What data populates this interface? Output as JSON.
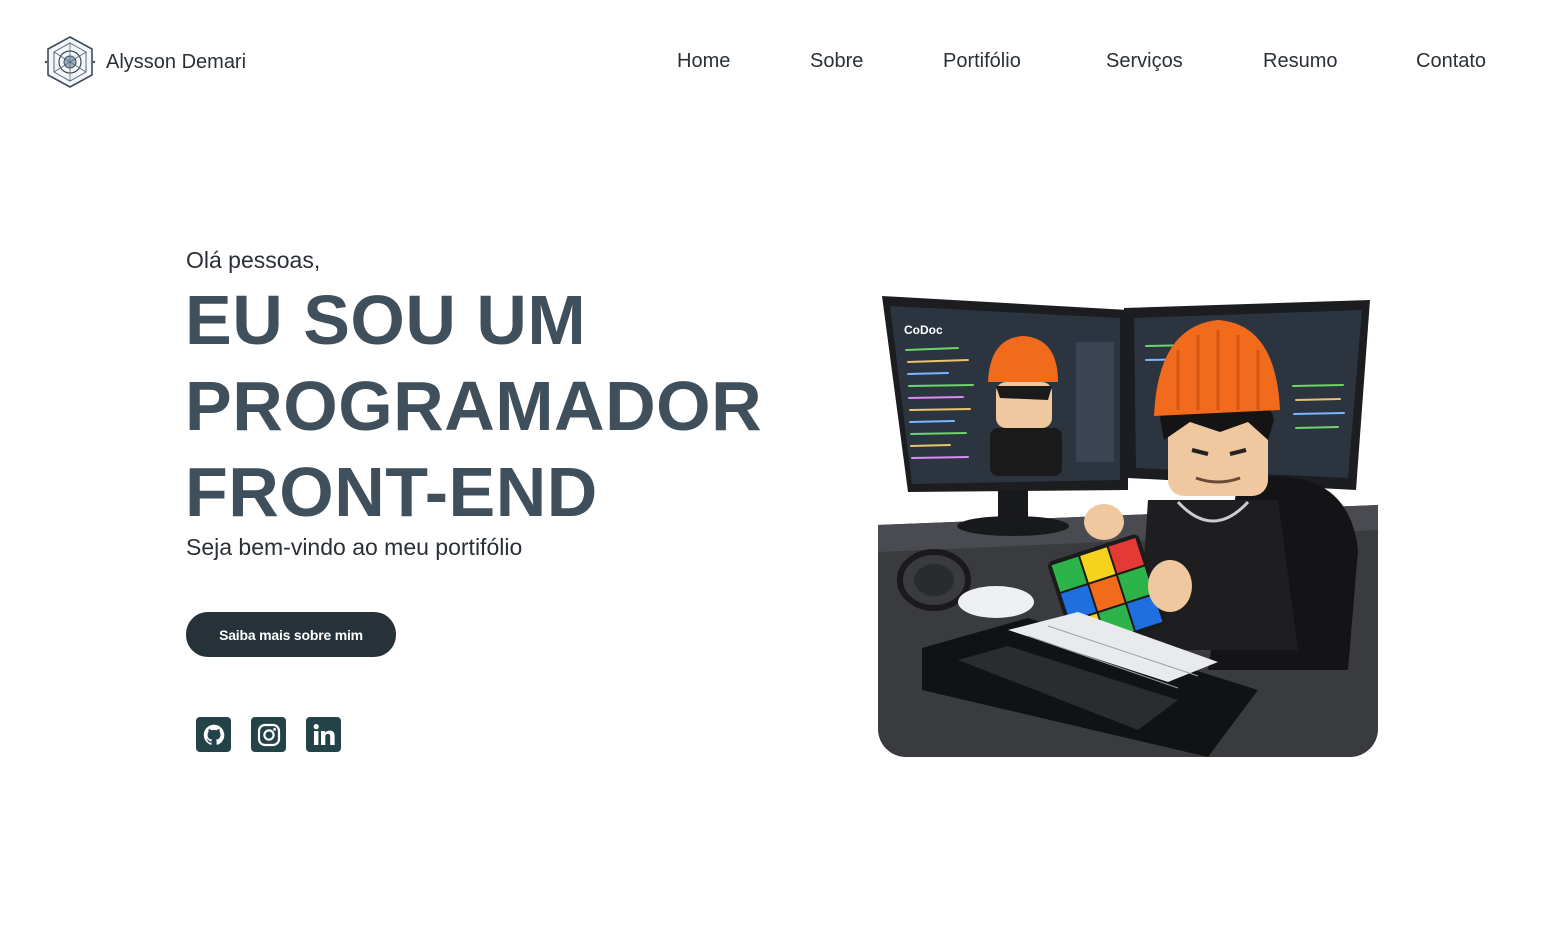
{
  "brand": {
    "name": "Alysson Demari",
    "logo_icon": "geometric-crest-icon"
  },
  "nav": {
    "items": [
      {
        "label": "Home"
      },
      {
        "label": "Sobre"
      },
      {
        "label": "Portifólio"
      },
      {
        "label": "Serviços"
      },
      {
        "label": "Resumo"
      },
      {
        "label": "Contato"
      }
    ]
  },
  "hero": {
    "greeting": "Olá pessoas,",
    "headline": [
      "EU SOU UM",
      "PROGRAMADOR",
      "FRONT-END"
    ],
    "subtitle": "Seja bem-vindo ao meu portifólio",
    "cta_label": "Saiba mais sobre mim",
    "image_icon": "lego-programmer-illustration",
    "screen_label": "CoDoc"
  },
  "socials": [
    {
      "icon": "github-icon"
    },
    {
      "icon": "instagram-icon"
    },
    {
      "icon": "linkedin-icon"
    }
  ],
  "colors": {
    "headline": "#3f4f5b",
    "button_bg": "#263238",
    "social_bg": "#234349",
    "text": "#2a3036",
    "beanie": "#f26a1b"
  }
}
